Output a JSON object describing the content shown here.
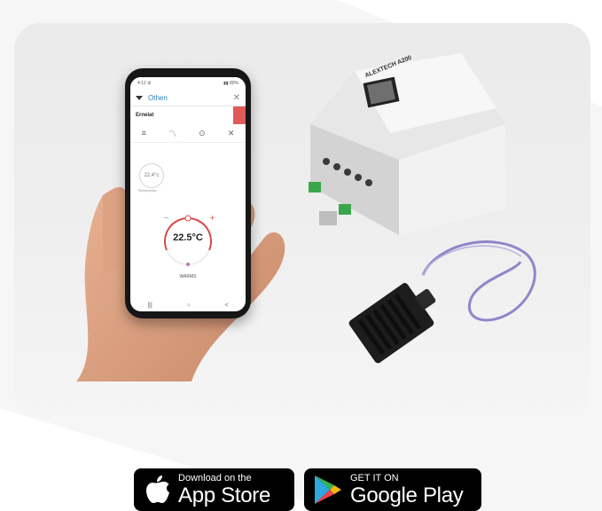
{
  "phone_app": {
    "status_left": "4:12 ⚙",
    "status_right": "▮▮ 80%",
    "header_title": "Othen",
    "close_glyph": "✕",
    "device_name": "Ernelat",
    "tabs": [
      "≡",
      "〽",
      "⊙",
      "✕"
    ],
    "small_temp": "22.4°c",
    "small_label": "Wolstanyolas",
    "setpoint": "22.5°C",
    "mode_label": "WARMS",
    "nav": [
      "|||",
      "○",
      "<"
    ]
  },
  "module": {
    "brand_label": "ALEXTECH A200",
    "qr_icon": "qr-code-icon"
  },
  "store_badges": {
    "apple": {
      "small": "Download on the",
      "big": "App Store"
    },
    "google": {
      "small": "GET IT ON",
      "big": "Google Play"
    }
  },
  "colors": {
    "accent_blue": "#2a7fb8",
    "power_red": "#e05a5a",
    "gauge_red": "#d94a4a",
    "sensor_wire": "#8f86c9"
  }
}
